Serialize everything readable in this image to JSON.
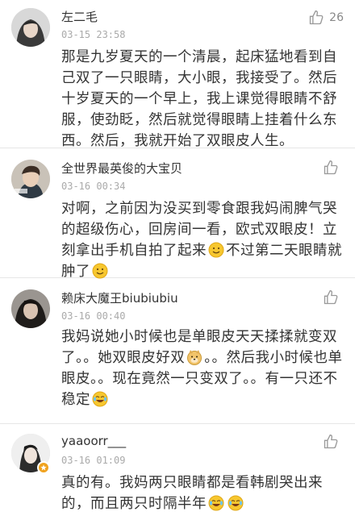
{
  "comments": [
    {
      "username": "左二毛",
      "timestamp": "03-15 23:58",
      "likes": "26",
      "text": "那是九岁夏天的一个清晨，起床猛地看到自己双了一只眼睛，大小眼，我接受了。然后十岁夏天的一个早上，我上课觉得眼睛不舒服，使劲眨，然后就觉得眼睛上挂着什么东西。然后，我就开始了双眼皮人生。"
    },
    {
      "username": "全世界最英俊的大宝贝",
      "timestamp": "03-16 00:34",
      "likes": "",
      "text_a": "对啊，之前因为没买到零食跟我妈闹脾气哭的超级伤心，回房间一看，欧式双眼皮！立刻拿出手机自拍了起来",
      "text_b": "不过第二天眼睛就肿了",
      "emoji": "smile-emoji"
    },
    {
      "username": "赖床大魔王biubiubiu",
      "timestamp": "03-16 00:40",
      "likes": "",
      "text_a": "我妈说她小时候也是单眼皮天天揉揉就变双了。。她双眼皮好双",
      "text_b": "。。然后我小时候也单眼皮。。现在竟然一只变双了。。有一只还不稳定",
      "emoji_a": "doge-emoji",
      "emoji_b": "laugh-cry-emoji"
    },
    {
      "username": "yaaoorr___",
      "timestamp": "03-16 01:09",
      "likes": "",
      "text": "真的有。我妈两只眼睛都是看韩剧哭出来的，而且两只时隔半年",
      "emoji": "laugh-cry-emoji"
    }
  ],
  "colors": {
    "username": "#333333",
    "timestamp": "#aaaaaa",
    "text": "#333333",
    "divider": "#e6e6e6",
    "badge": "#f0a21e"
  }
}
